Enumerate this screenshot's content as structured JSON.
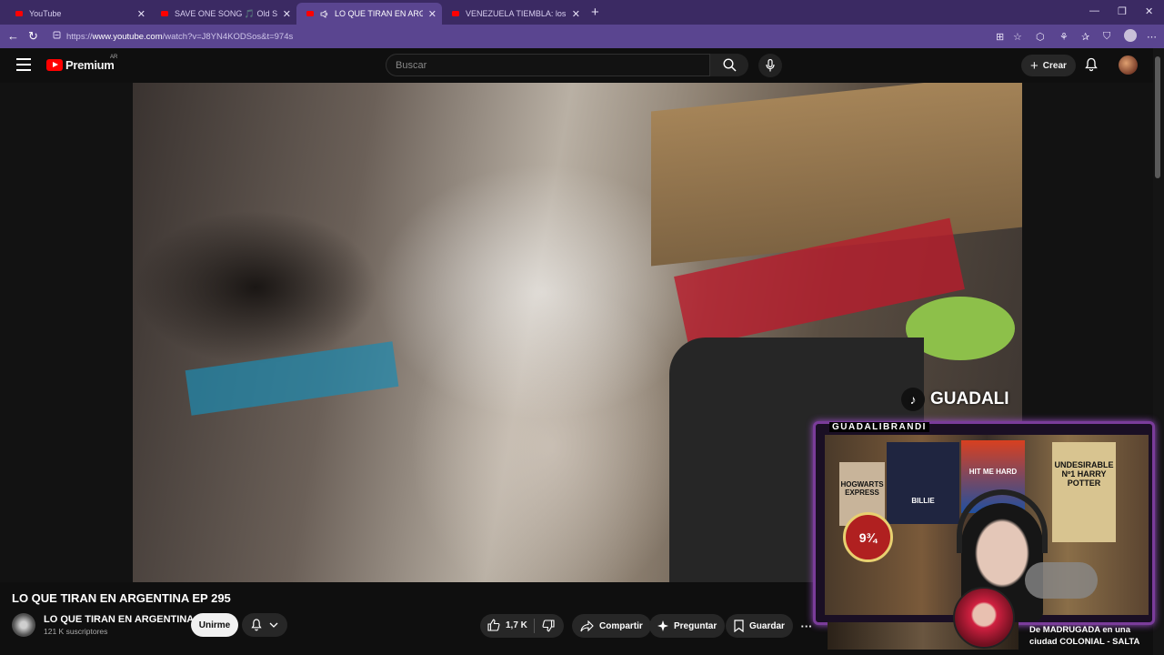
{
  "browser": {
    "tabs": [
      {
        "title": "YouTube",
        "active": false
      },
      {
        "title": "SAVE ONE SONG 🎵 Old Song vs",
        "active": false
      },
      {
        "title": "LO QUE TIRAN EN ARGENTIN",
        "active": true
      },
      {
        "title": "VENEZUELA TIEMBLA: los héroes",
        "active": false
      }
    ],
    "url_prefix": "https://",
    "url_host": "www.youtube.com",
    "url_path": "/watch?v=J8YN4KODSos&t=974s"
  },
  "youtube": {
    "logo_text": "Premium",
    "country_code": "AR",
    "search_placeholder": "Buscar",
    "create_label": "Crear"
  },
  "video": {
    "title": "LO QUE TIRAN EN ARGENTINA EP 295",
    "tiktok_watermark": "GUADALI",
    "streamer_name": "GUADALIBRANDI",
    "poster_hogwarts": "HOGWARTS EXPRESS",
    "poster_billie": "BILLIE",
    "poster_undesirable": "UNDESIRABLE Nº1 HARRY POTTER",
    "poster_platform": "9¾",
    "poster_hard": "HIT ME HARD"
  },
  "channel": {
    "name": "LO QUE TIRAN EN ARGENTINA",
    "subscribers": "121 K suscriptores",
    "join_label": "Unirme"
  },
  "actions": {
    "likes": "1,7 K",
    "share_label": "Compartir",
    "ask_label": "Preguntar",
    "save_label": "Guardar"
  },
  "recommendation": {
    "title": "De MADRUGADA en una ciudad COLONIAL - SALTA"
  },
  "colors": {
    "browser_frame": "#5a4590",
    "youtube_red": "#ff0000",
    "background": "#0f0f0f"
  }
}
